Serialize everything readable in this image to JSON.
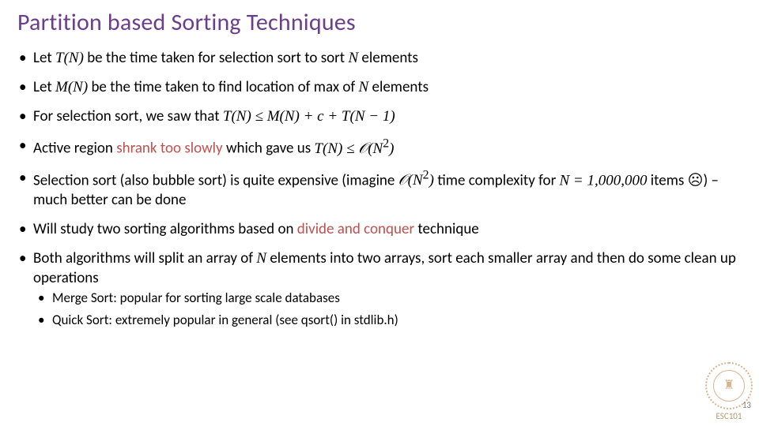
{
  "title": "Partition based Sorting Techniques",
  "bullets": {
    "b1_a": "Let ",
    "b1_m1": "T(N)",
    "b1_b": " be the time taken for selection sort to sort ",
    "b1_m2": "N",
    "b1_c": " elements",
    "b2_a": "Let ",
    "b2_m1": "M(N)",
    "b2_b": " be the time taken to find location of max of ",
    "b2_m2": "N",
    "b2_c": " elements",
    "b3_a": "For selection sort, we saw that ",
    "b3_m1": "T(N) ≤ M(N) + c + T(N − 1)",
    "b4_a": "Active region ",
    "b4_e": "shrank too slowly",
    "b4_b": " which gave us ",
    "b4_m1": "T(N) ≤ 𝒪(N",
    "b4_sup": "2",
    "b4_m2": ")",
    "b5_a": "Selection sort (also bubble sort) is quite expensive (imagine ",
    "b5_m1": "𝒪(N",
    "b5_sup": "2",
    "b5_m2": ")",
    "b5_b": " time complexity for ",
    "b5_m3": "N = 1,000,000",
    "b5_c": " items ☹) – much better can be done",
    "b6_a": "Will study two sorting algorithms based on ",
    "b6_e": "divide and conquer",
    "b6_b": " technique",
    "b7_a": "Both algorithms will split an array of ",
    "b7_m1": "N",
    "b7_b": " elements into two arrays, sort each smaller array and then do some clean up operations",
    "s1": "Merge Sort: popular for sorting large scale databases",
    "s2": "Quick Sort: extremely popular in general (see qsort() in stdlib.h)"
  },
  "footer": {
    "page": "13",
    "course": "ESC101",
    "seal_glyph": "♜"
  }
}
